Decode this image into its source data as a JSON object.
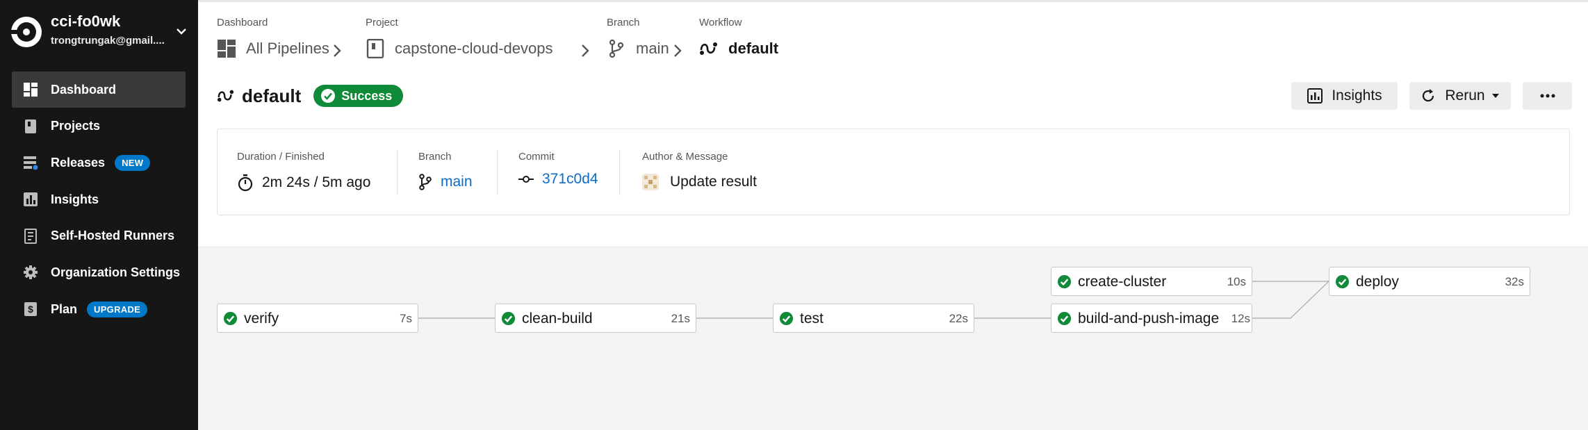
{
  "org": {
    "name": "cci-fo0wk",
    "email": "trongtrungak@gmail...."
  },
  "sidebar": {
    "items": [
      {
        "label": "Dashboard",
        "icon": "dashboard-icon",
        "active": true
      },
      {
        "label": "Projects",
        "icon": "projects-icon"
      },
      {
        "label": "Releases",
        "icon": "releases-icon",
        "badge": "NEW"
      },
      {
        "label": "Insights",
        "icon": "insights-icon"
      },
      {
        "label": "Self-Hosted Runners",
        "icon": "runners-icon"
      },
      {
        "label": "Organization Settings",
        "icon": "gear-icon"
      },
      {
        "label": "Plan",
        "icon": "plan-icon",
        "badge": "UPGRADE"
      }
    ]
  },
  "breadcrumb": {
    "dashboard": {
      "caption": "Dashboard",
      "value": "All Pipelines"
    },
    "project": {
      "caption": "Project",
      "value": "capstone-cloud-devops"
    },
    "branch": {
      "caption": "Branch",
      "value": "main"
    },
    "workflow": {
      "caption": "Workflow",
      "value": "default"
    }
  },
  "workflow": {
    "title": "default",
    "status": "Success",
    "status_color": "#0f8a38"
  },
  "actions": {
    "insights": "Insights",
    "rerun": "Rerun"
  },
  "summary": {
    "duration": {
      "caption": "Duration / Finished",
      "value": "2m 24s / 5m ago"
    },
    "branch": {
      "caption": "Branch",
      "value": "main"
    },
    "commit": {
      "caption": "Commit",
      "value": "371c0d4"
    },
    "author": {
      "caption": "Author & Message",
      "value": "Update result"
    }
  },
  "jobs": [
    {
      "name": "verify",
      "duration": "7s"
    },
    {
      "name": "clean-build",
      "duration": "21s"
    },
    {
      "name": "test",
      "duration": "22s"
    },
    {
      "name": "create-cluster",
      "duration": "10s"
    },
    {
      "name": "build-and-push-image",
      "duration": "12s"
    },
    {
      "name": "deploy",
      "duration": "32s"
    }
  ],
  "colors": {
    "sidebar_bg": "#161616",
    "link": "#0b6dc6",
    "badge": "#0078ca",
    "success": "#0f8a38"
  }
}
